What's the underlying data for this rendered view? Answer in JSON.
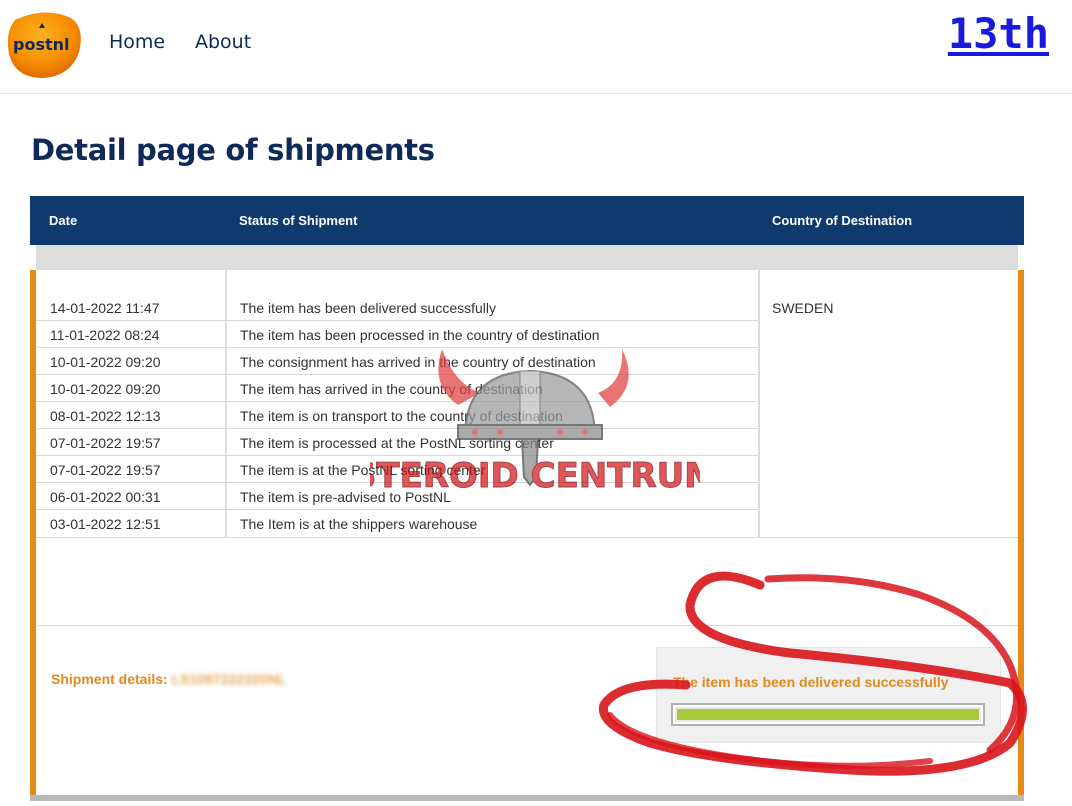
{
  "header": {
    "logo_text": "postnl",
    "nav": [
      {
        "label": "Home"
      },
      {
        "label": "About"
      }
    ],
    "right_link": "13th"
  },
  "page": {
    "title": "Detail page of shipments"
  },
  "table": {
    "columns": [
      "Date",
      "Status of Shipment",
      "Country of Destination"
    ],
    "country": "SWEDEN",
    "rows": [
      {
        "date": "14-01-2022 11:47",
        "status": "The item has been delivered successfully"
      },
      {
        "date": "11-01-2022 08:24",
        "status": "The item has been processed in the country of destination"
      },
      {
        "date": "10-01-2022 09:20",
        "status": "The consignment has arrived in the country of destination"
      },
      {
        "date": "10-01-2022 09:20",
        "status": "The item has arrived in the country of destination"
      },
      {
        "date": "08-01-2022 12:13",
        "status": "The item is on transport to the country of destination"
      },
      {
        "date": "07-01-2022 19:57",
        "status": "The item is processed at the PostNL sorting center"
      },
      {
        "date": "07-01-2022 19:57",
        "status": "The item is at the PostNL sorting center"
      },
      {
        "date": "06-01-2022 00:31",
        "status": "The item is pre-advised to PostNL"
      },
      {
        "date": "03-01-2022 12:51",
        "status": "The Item is at the shippers warehouse"
      }
    ]
  },
  "shipment": {
    "details_label": "Shipment details:",
    "code_blurred": "LS1097222220NL",
    "status_text": "The item has been delivered successfully",
    "progress": 1.0
  },
  "watermark": {
    "text": "STEROID CENTRUM"
  },
  "colors": {
    "navy": "#0e3a6e",
    "orange": "#e58a16",
    "progress_green": "#a7c83a",
    "scribble_red": "#d8141b"
  }
}
